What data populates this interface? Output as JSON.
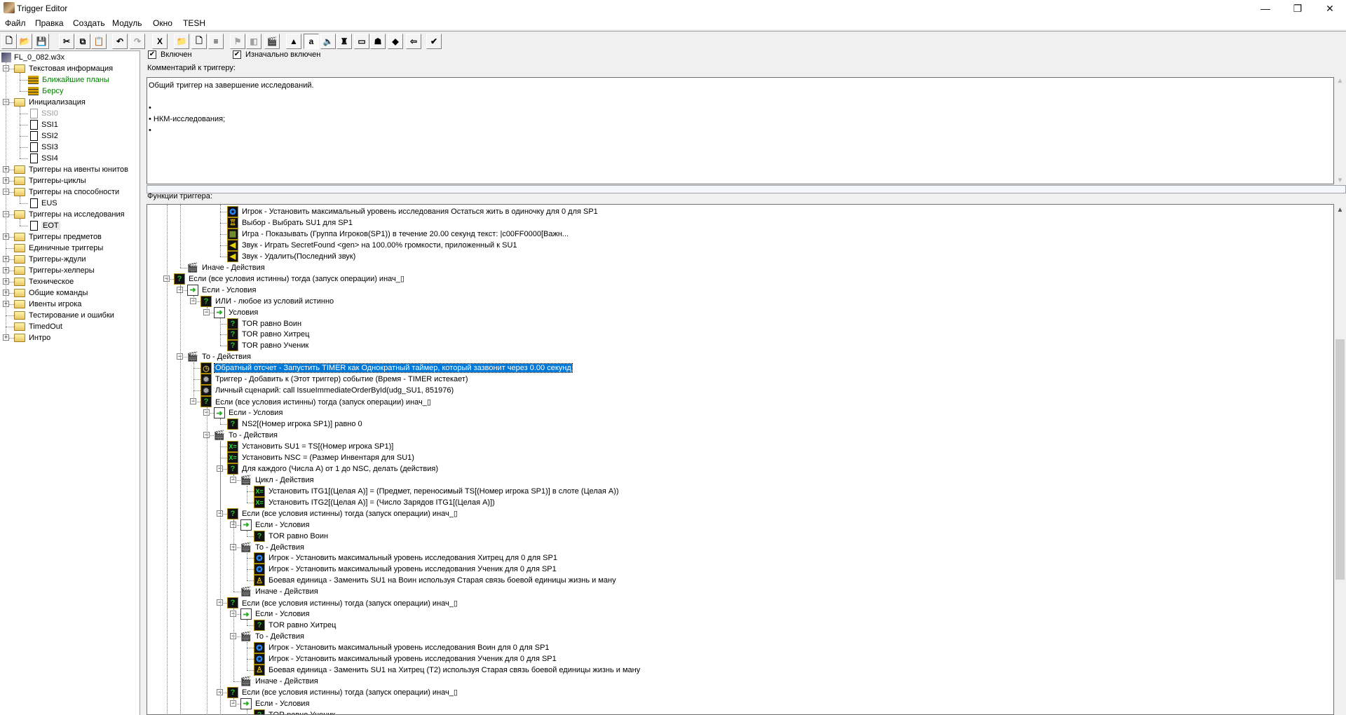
{
  "window": {
    "title": "Trigger Editor",
    "minimize": "—",
    "restore": "❐",
    "close": "✕"
  },
  "menu": [
    "Файл",
    "Правка",
    "Создать",
    "Модуль",
    "Окно",
    "TESH"
  ],
  "toolbar": [
    {
      "name": "new",
      "glyph": "🗋"
    },
    {
      "name": "open",
      "glyph": "📂"
    },
    {
      "name": "save",
      "glyph": "💾"
    },
    {
      "name": "cut",
      "glyph": "✂"
    },
    {
      "name": "copy",
      "glyph": "⧉"
    },
    {
      "name": "paste",
      "glyph": "📋"
    },
    {
      "name": "undo",
      "glyph": "↶"
    },
    {
      "name": "redo",
      "glyph": "↷",
      "disabled": true
    },
    {
      "name": "delete",
      "glyph": "X"
    },
    {
      "name": "new-category",
      "glyph": "📁"
    },
    {
      "name": "new-trigger",
      "glyph": "🗋"
    },
    {
      "name": "new-comment",
      "glyph": "≡"
    },
    {
      "name": "new-event",
      "glyph": "⚑",
      "disabled": true
    },
    {
      "name": "new-condition",
      "glyph": "◧",
      "disabled": true
    },
    {
      "name": "new-action",
      "glyph": "🎬"
    },
    {
      "name": "terrain-editor",
      "glyph": "▲"
    },
    {
      "name": "trigger-editor",
      "glyph": "a",
      "pressed": true
    },
    {
      "name": "sound-editor",
      "glyph": "🔈"
    },
    {
      "name": "object-editor",
      "glyph": "♜"
    },
    {
      "name": "campaign-editor",
      "glyph": "▭"
    },
    {
      "name": "ai-editor",
      "glyph": "☗"
    },
    {
      "name": "object-manager",
      "glyph": "◆"
    },
    {
      "name": "import-manager",
      "glyph": "⇦"
    },
    {
      "name": "test-map",
      "glyph": "✔"
    }
  ],
  "left_tree": [
    {
      "label": "FL_0_082.w3x",
      "level": 0,
      "icon": "map"
    },
    {
      "label": "Текстовая информация",
      "level": 1,
      "icon": "folder-open",
      "exp": "-"
    },
    {
      "label": "Ближайшие планы",
      "level": 2,
      "icon": "comment",
      "color": "#008000"
    },
    {
      "label": "Берсу",
      "level": 2,
      "icon": "comment",
      "color": "#008000"
    },
    {
      "label": "Инициализация",
      "level": 1,
      "icon": "folder-open",
      "exp": "-"
    },
    {
      "label": "SSI0",
      "level": 2,
      "icon": "doc-disabled",
      "color": "#999999"
    },
    {
      "label": "SSI1",
      "level": 2,
      "icon": "doc"
    },
    {
      "label": "SSI2",
      "level": 2,
      "icon": "doc"
    },
    {
      "label": "SSI3",
      "level": 2,
      "icon": "doc"
    },
    {
      "label": "SSI4",
      "level": 2,
      "icon": "doc"
    },
    {
      "label": "Триггеры на ивенты юнитов",
      "level": 1,
      "icon": "folder",
      "exp": "+"
    },
    {
      "label": "Триггеры-циклы",
      "level": 1,
      "icon": "folder",
      "exp": "+"
    },
    {
      "label": "Триггеры на способности",
      "level": 1,
      "icon": "folder-open",
      "exp": "-"
    },
    {
      "label": "EUS",
      "level": 2,
      "icon": "doc"
    },
    {
      "label": "Триггеры на исследования",
      "level": 1,
      "icon": "folder-open",
      "exp": "-"
    },
    {
      "label": "EOT",
      "level": 2,
      "icon": "doc",
      "selected": true
    },
    {
      "label": "Триггеры предметов",
      "level": 1,
      "icon": "folder",
      "exp": "+"
    },
    {
      "label": "Единичные триггеры",
      "level": 1,
      "icon": "folder"
    },
    {
      "label": "Триггеры-ждули",
      "level": 1,
      "icon": "folder",
      "exp": "+"
    },
    {
      "label": "Триггеры-хелперы",
      "level": 1,
      "icon": "folder",
      "exp": "+"
    },
    {
      "label": "Техническое",
      "level": 1,
      "icon": "folder",
      "exp": "+"
    },
    {
      "label": "Общие команды",
      "level": 1,
      "icon": "folder",
      "exp": "+"
    },
    {
      "label": "Ивенты игрока",
      "level": 1,
      "icon": "folder",
      "exp": "+"
    },
    {
      "label": "Тестирование и ошибки",
      "level": 1,
      "icon": "folder"
    },
    {
      "label": "TimedOut",
      "level": 1,
      "icon": "folder"
    },
    {
      "label": "Интро",
      "level": 1,
      "icon": "folder",
      "exp": "+"
    }
  ],
  "trigger": {
    "enabled_label": "Включен",
    "enabled": true,
    "initially_on_label": "Изначально включен",
    "initially_on": true,
    "comment_label": "Комментарий к триггеру:",
    "comment_lines": [
      "Общий триггер на завершение исследований.",
      "",
      "•",
      "• НКМ-исследования;",
      "•"
    ],
    "functions_label": "Функции триггера:"
  },
  "functions": [
    {
      "l": 4,
      "i": "player",
      "t": "Игрок - Установить максимальный уровень исследования Остаться жить в одиночку  для 0 для SP1"
    },
    {
      "l": 4,
      "i": "sel",
      "t": "Выбор - Выбрать SU1 для SP1"
    },
    {
      "l": 4,
      "i": "game",
      "t": "Игра - Показывать (Группа Игроков(SP1)) в течение 20.00 секунд текст: |c00FF0000[Важн..."
    },
    {
      "l": 4,
      "i": "snd",
      "t": "Звук - Играть SecretFound <gen> на 100.00% громкости, приложенный к SU1"
    },
    {
      "l": 4,
      "i": "snd",
      "t": "Звук - Удалить(Последний звук)"
    },
    {
      "l": 1,
      "i": "clap",
      "t": "Иначе - Действия"
    },
    {
      "l": 0,
      "i": "q",
      "e": 1,
      "t": "Если (все условия истинны) тогда (запуск операции) инач_▯"
    },
    {
      "l": 1,
      "i": "cond",
      "e": 1,
      "t": "Если - Условия"
    },
    {
      "l": 2,
      "i": "q",
      "e": 1,
      "t": "ИЛИ - любое из условий истинно"
    },
    {
      "l": 3,
      "i": "cond",
      "e": 1,
      "t": "Условия"
    },
    {
      "l": 4,
      "i": "q",
      "t": "TOR равно Воин"
    },
    {
      "l": 4,
      "i": "q",
      "t": "TOR равно Хитрец"
    },
    {
      "l": 4,
      "i": "q",
      "t": "TOR равно Ученик"
    },
    {
      "l": 1,
      "i": "clap",
      "e": 1,
      "t": "То - Действия"
    },
    {
      "l": 2,
      "i": "timer",
      "t": "Обратный отсчет - Запустить TIMER как Однократный таймер, который зазвонит через 0.00 секунд",
      "selected": true
    },
    {
      "l": 2,
      "i": "gear",
      "t": "Триггер - Добавить к (Этот триггер) событие (Время - TIMER истекает)"
    },
    {
      "l": 2,
      "i": "gear",
      "t": "Личный сценарий: call IssueImmediateOrderById(udg_SU1, 851976)"
    },
    {
      "l": 2,
      "i": "q",
      "e": 1,
      "t": "Если (все условия истинны) тогда (запуск операции) инач_▯"
    },
    {
      "l": 3,
      "i": "cond",
      "e": 1,
      "t": "Если - Условия"
    },
    {
      "l": 4,
      "i": "q",
      "t": "NS2[(Номер игрока SP1)] равно 0"
    },
    {
      "l": 3,
      "i": "clap",
      "e": 1,
      "t": "То - Действия"
    },
    {
      "l": 4,
      "i": "setv",
      "t": "Установить SU1 = TS[(Номер игрока SP1)]"
    },
    {
      "l": 4,
      "i": "setv",
      "t": "Установить NSC = (Размер Инвентаря для SU1)"
    },
    {
      "l": 4,
      "i": "q",
      "e": 1,
      "t": "Для каждого (Числа A) от 1 до NSC, делать (действия)"
    },
    {
      "l": 5,
      "i": "clap",
      "e": 1,
      "t": "Цикл - Действия"
    },
    {
      "l": 6,
      "i": "setv",
      "t": "Установить ITG1[(Целая A)] = (Предмет, переносимый TS[(Номер игрока SP1)] в слоте (Целая A))"
    },
    {
      "l": 6,
      "i": "setv",
      "t": "Установить ITG2[(Целая A)] = (Число Зарядов ITG1[(Целая A)])"
    },
    {
      "l": 4,
      "i": "q",
      "e": 1,
      "t": "Если (все условия истинны) тогда (запуск операции) инач_▯"
    },
    {
      "l": 5,
      "i": "cond",
      "e": 1,
      "t": "Если - Условия"
    },
    {
      "l": 6,
      "i": "q",
      "t": "TOR равно Воин"
    },
    {
      "l": 5,
      "i": "clap",
      "e": 1,
      "t": "То - Действия"
    },
    {
      "l": 6,
      "i": "player",
      "t": "Игрок - Установить максимальный уровень исследования Хитрец  для 0 для SP1"
    },
    {
      "l": 6,
      "i": "player",
      "t": "Игрок - Установить максимальный уровень исследования Ученик  для 0 для SP1"
    },
    {
      "l": 6,
      "i": "unit",
      "t": "Боевая единица - Заменить SU1 на Воин используя Старая связь боевой единицы жизнь и ману"
    },
    {
      "l": 5,
      "i": "clap",
      "t": "Иначе - Действия"
    },
    {
      "l": 4,
      "i": "q",
      "e": 1,
      "t": "Если (все условия истинны) тогда (запуск операции) инач_▯"
    },
    {
      "l": 5,
      "i": "cond",
      "e": 1,
      "t": "Если - Условия"
    },
    {
      "l": 6,
      "i": "q",
      "t": "TOR равно Хитрец"
    },
    {
      "l": 5,
      "i": "clap",
      "e": 1,
      "t": "То - Действия"
    },
    {
      "l": 6,
      "i": "player",
      "t": "Игрок - Установить максимальный уровень исследования Воин  для 0 для SP1"
    },
    {
      "l": 6,
      "i": "player",
      "t": "Игрок - Установить максимальный уровень исследования Ученик  для 0 для SP1"
    },
    {
      "l": 6,
      "i": "unit",
      "t": "Боевая единица - Заменить SU1 на Хитрец (T2) используя Старая связь боевой единицы жизнь и ману"
    },
    {
      "l": 5,
      "i": "clap",
      "t": "Иначе - Действия"
    },
    {
      "l": 4,
      "i": "q",
      "e": 1,
      "t": "Если (все условия истинны) тогда (запуск операции) инач_▯"
    },
    {
      "l": 5,
      "i": "cond",
      "e": 1,
      "t": "Если - Условия"
    },
    {
      "l": 6,
      "i": "q",
      "t": "TOR равно Ученик"
    }
  ],
  "icon_glyphs": {
    "q": "?",
    "cond": "➜",
    "clap": "🎬",
    "player": "✪",
    "sel": "♖",
    "game": "▦",
    "snd": "◀",
    "timer": "◷",
    "gear": "✹",
    "setv": "X=",
    "unit": "♙"
  },
  "scroll": {
    "function_tree_position": 0.5
  }
}
